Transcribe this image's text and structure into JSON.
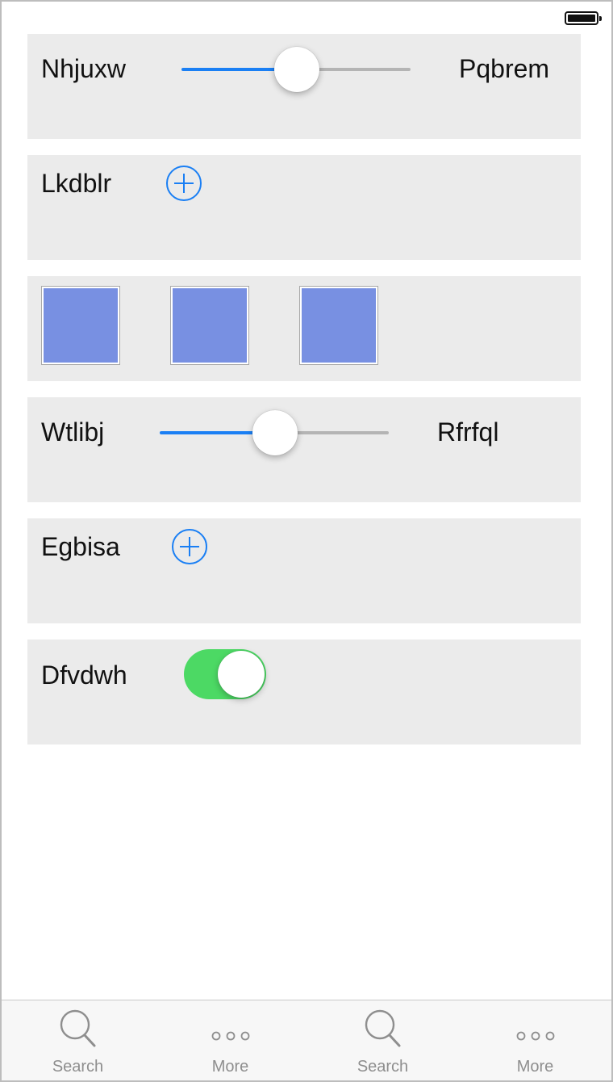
{
  "status_bar": {
    "battery_level": 1.0
  },
  "rows": {
    "slider1": {
      "left_label": "Nhjuxw",
      "right_label": "Pqbrem",
      "value": 0.5
    },
    "add1": {
      "label": "Lkdblr"
    },
    "swatches": {
      "count": 3,
      "color": "#7890e2"
    },
    "slider2": {
      "left_label": "Wtlibj",
      "right_label": "Rfrfql",
      "value": 0.5
    },
    "add2": {
      "label": "Egbisa"
    },
    "toggle": {
      "label": "Dfvdwh",
      "on": true,
      "on_color": "#4cd964"
    }
  },
  "accent_color": "#1a7ff4",
  "tab_bar": {
    "tabs": [
      {
        "label": "Search",
        "icon": "search-icon"
      },
      {
        "label": "More",
        "icon": "more-icon"
      },
      {
        "label": "Search",
        "icon": "search-icon"
      },
      {
        "label": "More",
        "icon": "more-icon"
      }
    ]
  }
}
